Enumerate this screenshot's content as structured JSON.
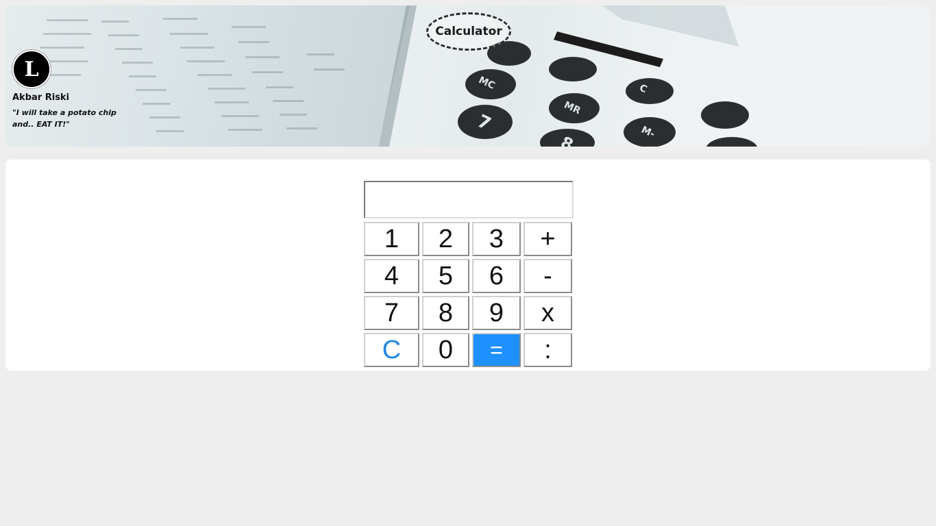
{
  "header": {
    "title": "Calculator",
    "avatar_letter": "L",
    "author_name": "Akbar Riski",
    "author_quote": "\"I will take a potato chip and.. EAT IT!\""
  },
  "calculator": {
    "display_value": "",
    "keys": {
      "k1": "1",
      "k2": "2",
      "k3": "3",
      "plus": "+",
      "k4": "4",
      "k5": "5",
      "k6": "6",
      "minus": "-",
      "k7": "7",
      "k8": "8",
      "k9": "9",
      "times": "x",
      "clear": "C",
      "k0": "0",
      "equals": "=",
      "divide": ":"
    }
  },
  "colors": {
    "page_bg": "#eeeeee",
    "accent_blue": "#1e90ff",
    "clear_text": "#1e88e5"
  }
}
